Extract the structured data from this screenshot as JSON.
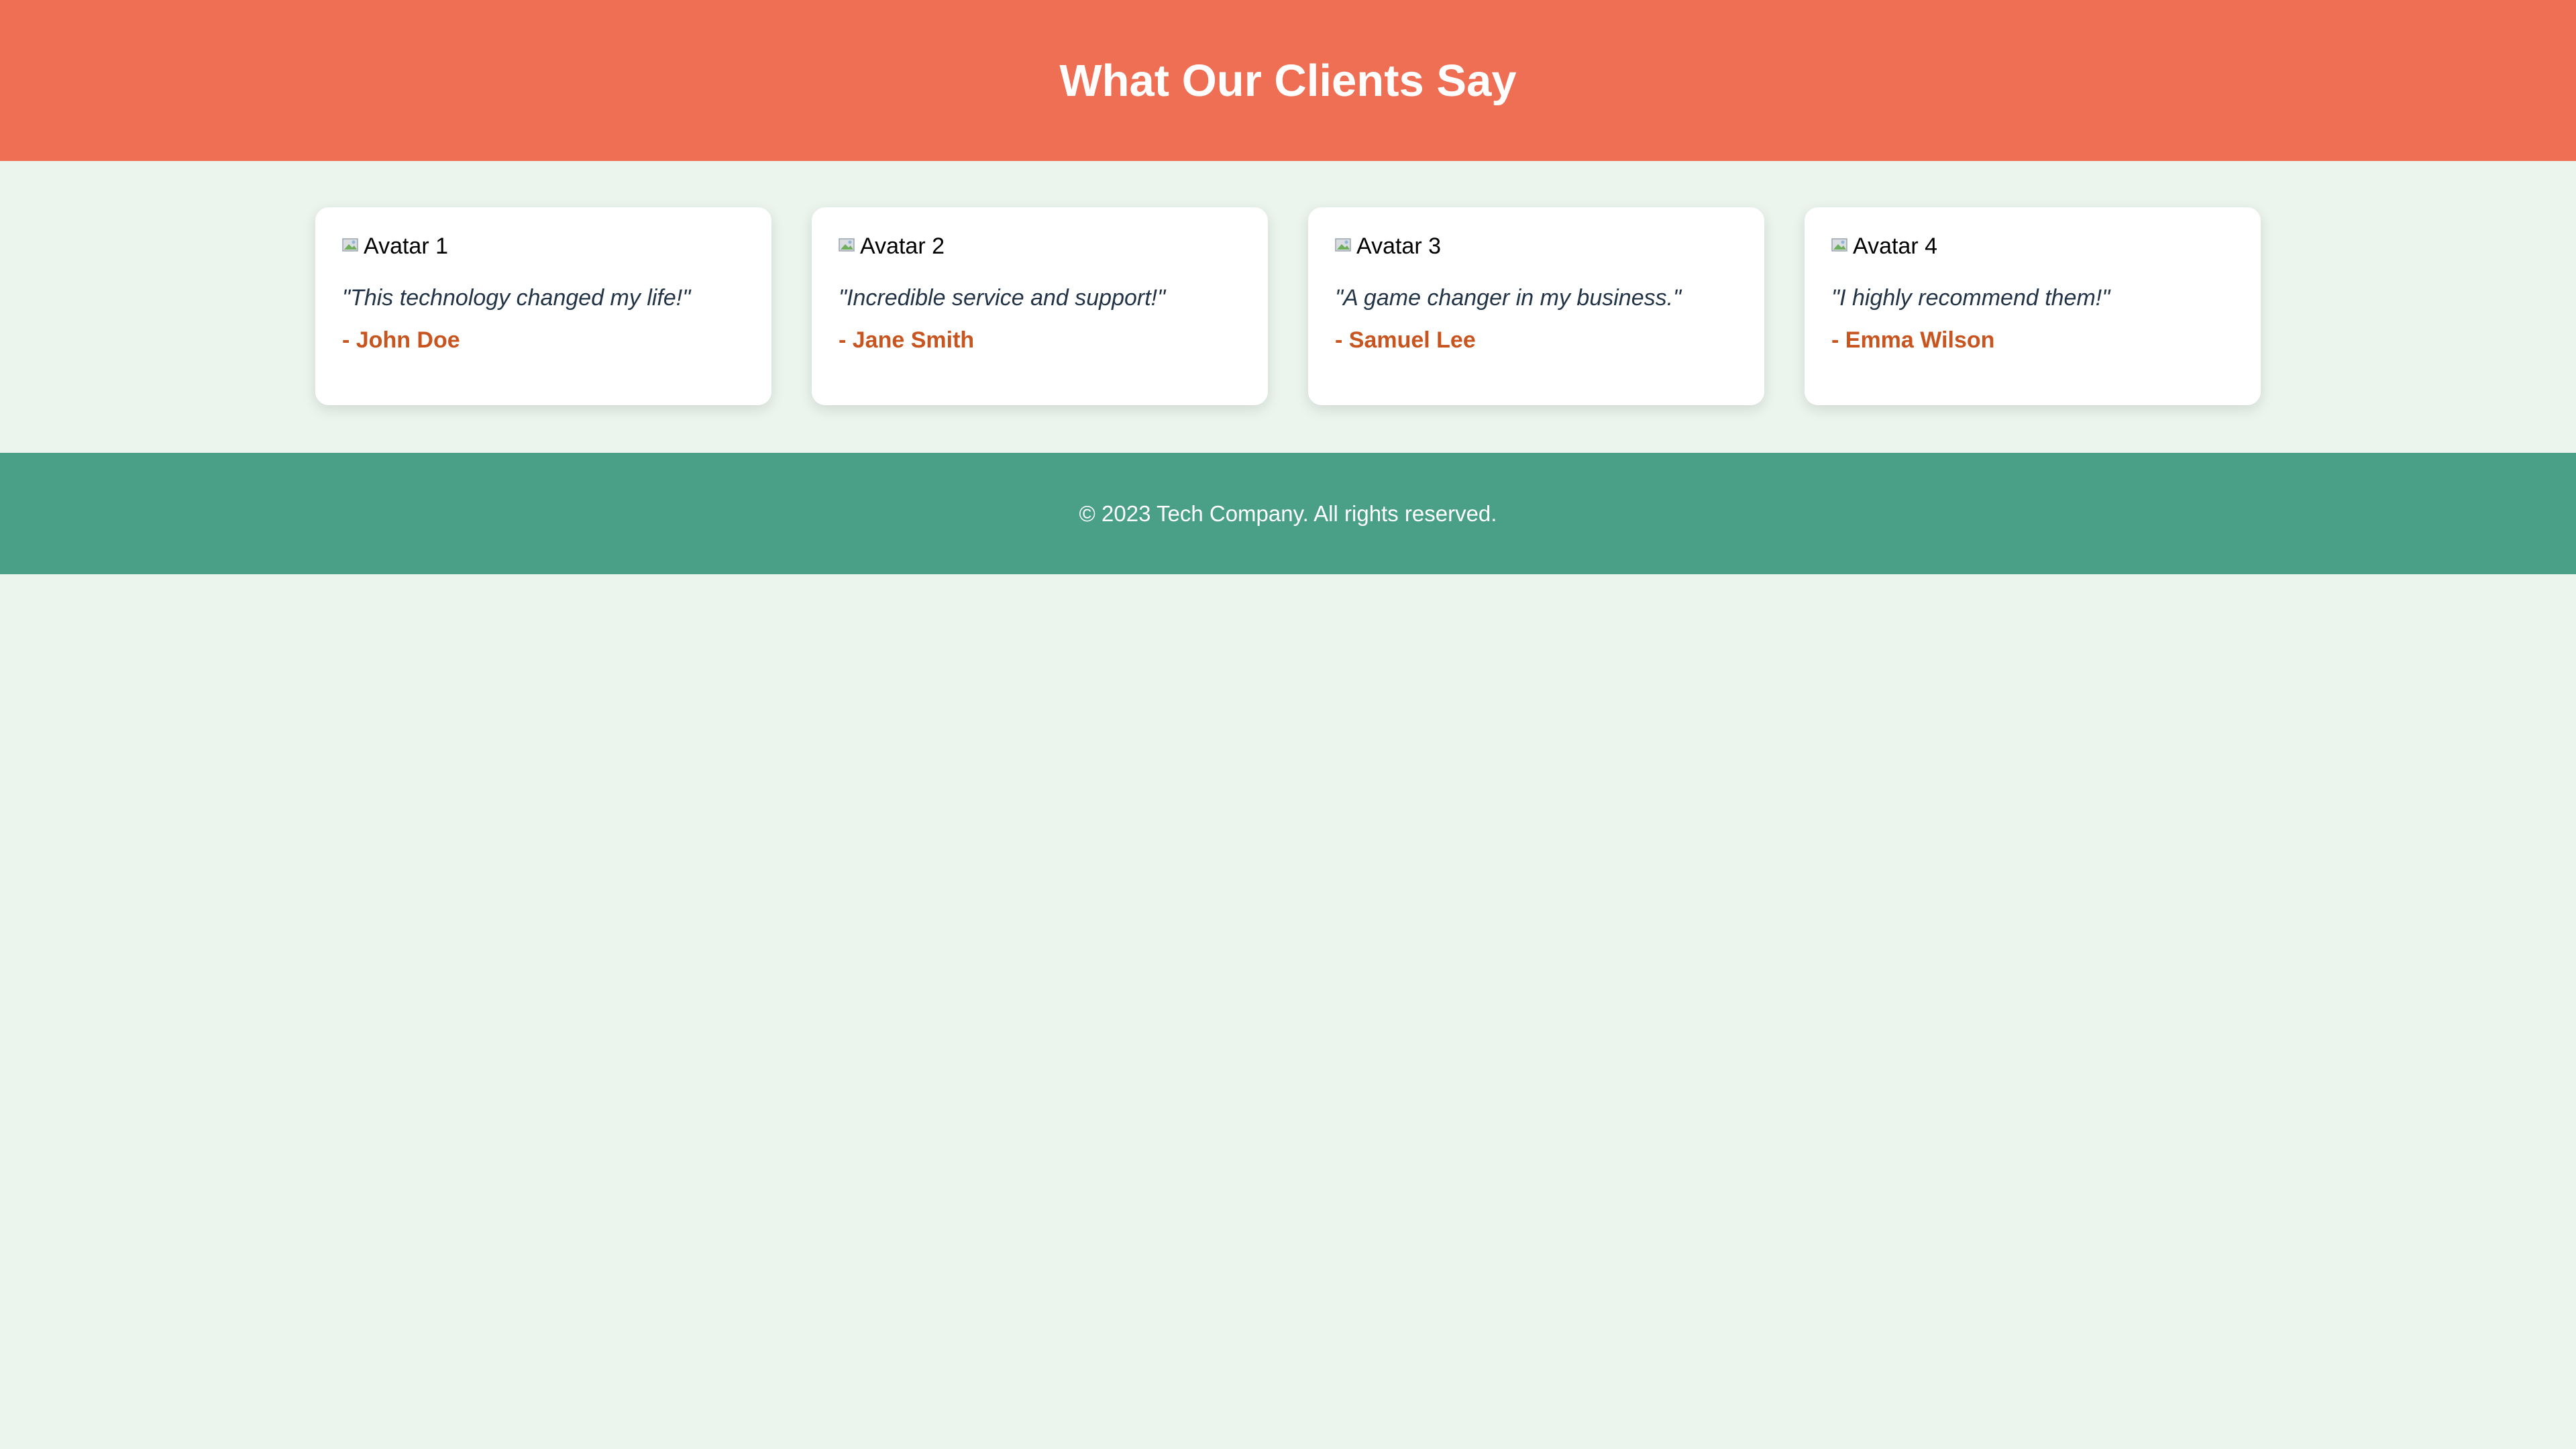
{
  "header": {
    "title": "What Our Clients Say"
  },
  "testimonials": [
    {
      "avatar_alt": "Avatar 1",
      "quote": "\"This technology changed my life!\"",
      "author": "- John Doe"
    },
    {
      "avatar_alt": "Avatar 2",
      "quote": "\"Incredible service and support!\"",
      "author": "- Jane Smith"
    },
    {
      "avatar_alt": "Avatar 3",
      "quote": "\"A game changer in my business.\"",
      "author": "- Samuel Lee"
    },
    {
      "avatar_alt": "Avatar 4",
      "quote": "\"I highly recommend them!\"",
      "author": "- Emma Wilson"
    }
  ],
  "footer": {
    "text": "© 2023 Tech Company. All rights reserved."
  },
  "colors": {
    "header_bg": "#ef6f55",
    "page_bg": "#ebf5ee",
    "footer_bg": "#4a9f87",
    "author": "#c8541f",
    "quote": "#243447"
  },
  "icons": {
    "avatar": "broken-image-icon"
  }
}
